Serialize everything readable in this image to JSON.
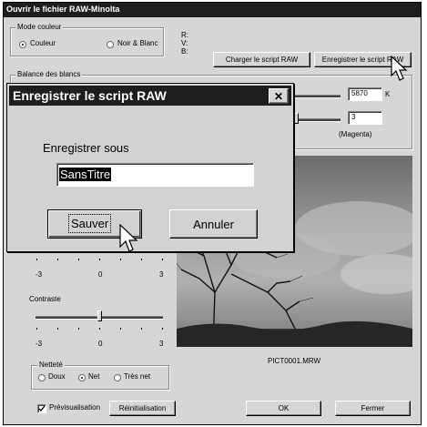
{
  "main_window": {
    "title": "Ouvrir le fichier RAW-Minolta",
    "mode_couleur": {
      "label": "Mode couleur",
      "option_color": "Couleur",
      "option_bw": "Noir & Blanc",
      "selected": "Couleur"
    },
    "rgb_labels": {
      "r": "R:",
      "v": "V:",
      "b": "B:"
    },
    "load_script_button": "Charger le script RAW",
    "save_script_button": "Enregistrer le script RAW",
    "white_balance": {
      "label": "Balance des blancs",
      "temperature_value": "5870",
      "temperature_unit": "K",
      "tint_value": "3",
      "tint_label": "(Magenta)"
    },
    "slider1": {
      "min": "-3",
      "mid": "0",
      "max": "3"
    },
    "contrast": {
      "label": "Contraste",
      "min": "-3",
      "mid": "0",
      "max": "3",
      "level": 0.5
    },
    "sharpness": {
      "label": "Netteté",
      "option_soft": "Doux",
      "option_normal": "Net",
      "option_hard": "Très net",
      "selected": "Net"
    },
    "preview_checkbox": {
      "label": "Prévisualisation",
      "checked": true
    },
    "reset_button": "Réinitialisation",
    "filename": "PICT0001.MRW",
    "ok_button": "OK",
    "close_button": "Fermer"
  },
  "dialog": {
    "title": "Enregistrer le script RAW",
    "prompt": "Enregistrer sous",
    "filename_value": "SansTitre",
    "save_button": "Sauver",
    "cancel_button": "Annuler",
    "close_glyph": "✕"
  },
  "colors": {
    "title_bar": "#1e1e1e",
    "window_bg": "#d6d6d6",
    "preview_sky": "#8a8a8a",
    "dialog_bg": "#d2d2d2"
  },
  "icons": {
    "cursor": "arrow-cursor-icon",
    "close": "close-icon"
  }
}
